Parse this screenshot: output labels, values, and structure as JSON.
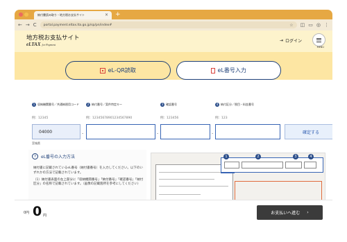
{
  "browser": {
    "tab_title": "納付書読み取り・地方税お支払サイト",
    "tab_close": "×",
    "new_tab": "+",
    "url": "portal.payment.eltax.lta.go.jp/sp/pn/index#",
    "back": "←",
    "forward": "→",
    "reload": "C",
    "menu_dots": "⋮"
  },
  "header": {
    "title": "地方税お支払サイト",
    "logo": "eLTAX",
    "logo_sub": "for Payment",
    "login": "ログイン",
    "menu_label": "MENU"
  },
  "mode_tabs": [
    {
      "label": "eL-QR読取",
      "active": false
    },
    {
      "label": "eL番号入力",
      "active": true
    }
  ],
  "fields": [
    {
      "num": "1",
      "label": "収納機関番号／共通納税用コード",
      "example": "例：12345",
      "value": "04000",
      "below": "宮城県"
    },
    {
      "num": "2",
      "label": "納付番号／案件特定キー",
      "example": "例：12345678901234567890",
      "value": ""
    },
    {
      "num": "3",
      "label": "確認番号",
      "example": "例：123456",
      "value": ""
    },
    {
      "num": "4",
      "label": "納付区分／税目・料金番号",
      "example": "例：123",
      "value": ""
    }
  ],
  "dash": "-",
  "confirm_button": "確定する",
  "howto": {
    "title": "eL番号の入力方法",
    "para1": "納付書に記載されているeL番号（納付書番号）を入力してください。以下のいずれかの方法で記載されています。",
    "para2": "（1）納付書表面の左上部分に「収納機関番号」「納付番号」「確認番号」「納付区分」の名称で記載されています。（画像の記載箇所を参考にしてください）"
  },
  "sample": {
    "numbers": [
      "1",
      "2",
      "3",
      "4"
    ]
  },
  "footer": {
    "yen_label": "0円",
    "amount": "0",
    "unit": "円",
    "pay_button": "お支払いへ進む",
    "pay_arrow": "›"
  }
}
